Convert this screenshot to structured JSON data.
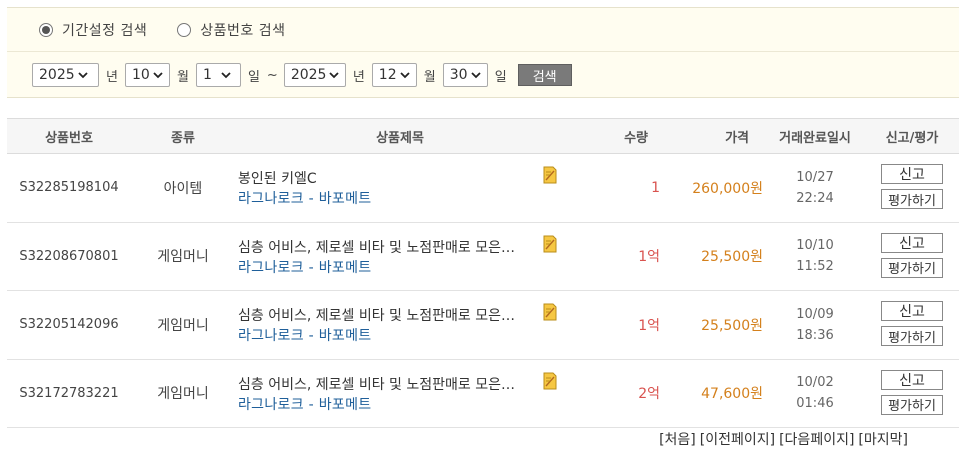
{
  "search": {
    "radio_options": [
      {
        "label": "기간설정 검색",
        "checked": true
      },
      {
        "label": "상품번호 검색",
        "checked": false
      }
    ],
    "start_year": "2025",
    "start_month": "10",
    "start_day": "1",
    "end_year": "2025",
    "end_month": "12",
    "end_day": "30",
    "unit_year": "년",
    "unit_month": "월",
    "unit_day": "일",
    "range_sep": "~",
    "button_label": "검색"
  },
  "table": {
    "headers": {
      "id": "상품번호",
      "kind": "종류",
      "title": "상품제목",
      "qty": "수량",
      "price": "가격",
      "date": "거래완료일시",
      "action": "신고/평가"
    },
    "rows": [
      {
        "id": "S32285198104",
        "kind": "아이템",
        "title": "봉인된 키엘C",
        "server": "라그나로크 - 바포메트",
        "qty": "1",
        "price": "260,000원",
        "date": "10/27",
        "time": "22:24",
        "report": "신고",
        "rate": "평가하기"
      },
      {
        "id": "S32208670801",
        "kind": "게임머니",
        "title": "심층 어비스, 제로셀 비타 및 노점판매로 모은…",
        "server": "라그나로크 - 바포메트",
        "qty": "1억",
        "price": "25,500원",
        "date": "10/10",
        "time": "11:52",
        "report": "신고",
        "rate": "평가하기"
      },
      {
        "id": "S32205142096",
        "kind": "게임머니",
        "title": "심층 어비스, 제로셀 비타 및 노점판매로 모은…",
        "server": "라그나로크 - 바포메트",
        "qty": "1억",
        "price": "25,500원",
        "date": "10/09",
        "time": "18:36",
        "report": "신고",
        "rate": "평가하기"
      },
      {
        "id": "S32172783221",
        "kind": "게임머니",
        "title": "심층 어비스, 제로셀 비타 및 노점판매로 모은…",
        "server": "라그나로크 - 바포메트",
        "qty": "2억",
        "price": "47,600원",
        "date": "10/02",
        "time": "01:46",
        "report": "신고",
        "rate": "평가하기"
      }
    ]
  },
  "pager": {
    "first": "[처음]",
    "prev": "[이전페이지]",
    "next": "[다음페이지]",
    "last": "[마지막]"
  },
  "colors": {
    "panel_bg": "#fffdf0",
    "qty": "#d9534f",
    "price": "#d4801c",
    "server_link": "#1f5f9a",
    "search_button": "#7a7a7a"
  },
  "icons": {
    "title_icon": "note-icon",
    "select_caret": "chevron-down-icon"
  }
}
